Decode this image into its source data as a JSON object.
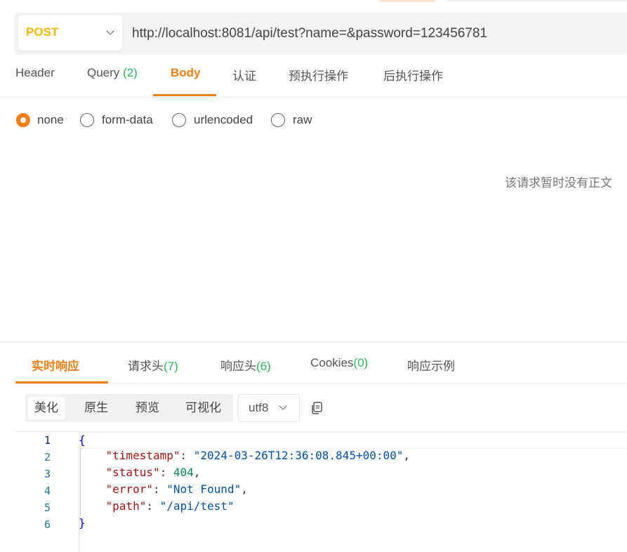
{
  "request": {
    "method": "POST",
    "url": "http://localhost:8081/api/test?name=&password=123456781"
  },
  "request_tabs": {
    "header": "Header",
    "query": "Query",
    "query_count": "(2)",
    "body": "Body",
    "auth": "认证",
    "pre_script": "预执行操作",
    "post_script": "后执行操作"
  },
  "body_types": {
    "none": "none",
    "form_data": "form-data",
    "urlencoded": "urlencoded",
    "raw": "raw",
    "selected": "none"
  },
  "empty_body_text": "该请求暂时没有正文",
  "response_tabs": {
    "live": "实时响应",
    "req_headers": "请求头",
    "req_headers_count": "(7)",
    "res_headers": "响应头",
    "res_headers_count": "(6)",
    "cookies": "Cookies",
    "cookies_count": "(0)",
    "example": "响应示例"
  },
  "format_buttons": {
    "pretty": "美化",
    "raw": "原生",
    "preview": "预览",
    "visualize": "可视化"
  },
  "encoding": "utf8",
  "response_code": {
    "line_numbers": [
      "1",
      "2",
      "3",
      "4",
      "5",
      "6"
    ],
    "open_brace": "{",
    "close_brace": "}",
    "timestamp_key": "\"timestamp\"",
    "timestamp_val": "\"2024-03-26T12:36:08.845+00:00\"",
    "status_key": "\"status\"",
    "status_val": "404",
    "error_key": "\"error\"",
    "error_val": "\"Not Found\"",
    "path_key": "\"path\"",
    "path_val": "\"/api/test\""
  },
  "colors": {
    "accent": "#f37e14",
    "method_post": "#f7b600",
    "count_green": "#2fb65b"
  }
}
